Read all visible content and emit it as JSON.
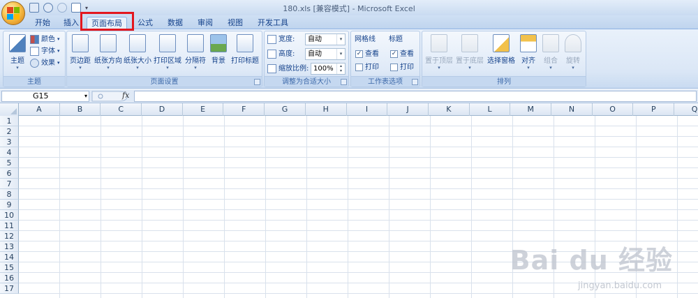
{
  "window": {
    "title": "180.xls  [兼容模式] - Microsoft Excel"
  },
  "tabs": [
    {
      "label": "开始"
    },
    {
      "label": "插入"
    },
    {
      "label": "页面布局",
      "active": true
    },
    {
      "label": "公式"
    },
    {
      "label": "数据"
    },
    {
      "label": "审阅"
    },
    {
      "label": "视图"
    },
    {
      "label": "开发工具"
    }
  ],
  "ribbon": {
    "theme_group": {
      "label": "主题",
      "theme_button": "主题",
      "colors": "颜色",
      "fonts": "字体",
      "effects": "效果"
    },
    "page_setup": {
      "label": "页面设置",
      "margins": "页边距",
      "orientation": "纸张方向",
      "size": "纸张大小",
      "print_area": "打印区域",
      "breaks": "分隔符",
      "background": "背景",
      "print_titles": "打印标题"
    },
    "scale_to_fit": {
      "label": "调整为合适大小",
      "width_label": "宽度:",
      "width_value": "自动",
      "height_label": "高度:",
      "height_value": "自动",
      "scale_label": "缩放比例:",
      "scale_value": "100%"
    },
    "sheet_options": {
      "label": "工作表选项",
      "gridlines": "网格线",
      "headings": "标题",
      "view": "查看",
      "print": "打印"
    },
    "arrange": {
      "label": "排列",
      "bring_front": "置于顶层",
      "send_back": "置于底层",
      "selection_pane": "选择窗格",
      "align": "对齐",
      "group": "组合",
      "rotate": "旋转"
    }
  },
  "formula_bar": {
    "name_box": "G15",
    "fx": "fx",
    "value": ""
  },
  "columns": [
    "A",
    "B",
    "C",
    "D",
    "E",
    "F",
    "G",
    "H",
    "I",
    "J",
    "K",
    "L",
    "M",
    "N",
    "O",
    "P",
    "Q"
  ],
  "rows": [
    "1",
    "2",
    "3",
    "4",
    "5",
    "6",
    "7",
    "8",
    "9",
    "10",
    "11",
    "12",
    "13",
    "14",
    "15",
    "16",
    "17"
  ],
  "watermark": {
    "brand": "Bai du 经验",
    "url": "jingyan.baidu.com"
  },
  "colors": {
    "accent": "#15428b",
    "highlight": "#e3161e"
  }
}
